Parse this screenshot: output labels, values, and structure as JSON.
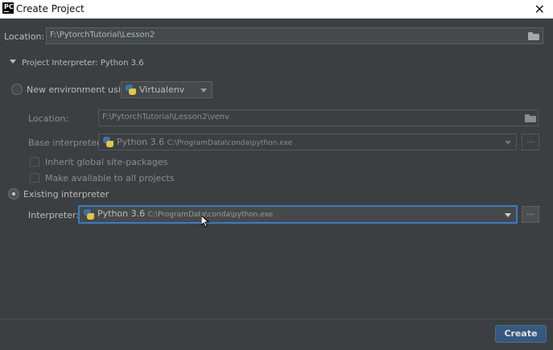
{
  "window": {
    "title": "Create Project"
  },
  "location": {
    "label": "Location:",
    "value": "F:\\PytorchTutorial\\Lesson2"
  },
  "interpreter_section": {
    "title": "Project Interpreter: Python 3.6"
  },
  "new_env": {
    "radio_label": "New environment using",
    "tool": "Virtualenv",
    "location_label": "Location:",
    "location_value": "F:\\PytorchTutorial\\Lesson2\\venv",
    "base_label": "Base interpreter:",
    "base_name": "Python 3.6",
    "base_path": "C:\\ProgramData\\conda\\python.exe",
    "inherit_label": "Inherit global site-packages",
    "available_label": "Make available to all projects",
    "browse_label": "..."
  },
  "existing": {
    "radio_label": "Existing interpreter",
    "interpreter_label": "Interpreter:",
    "interpreter_name": "Python 3.6",
    "interpreter_path": "C:\\ProgramData\\conda\\python.exe",
    "browse_label": "..."
  },
  "footer": {
    "create_label": "Create"
  },
  "colors": {
    "background": "#3c3f41",
    "accent": "#365880",
    "focus": "#3d7ac5"
  }
}
